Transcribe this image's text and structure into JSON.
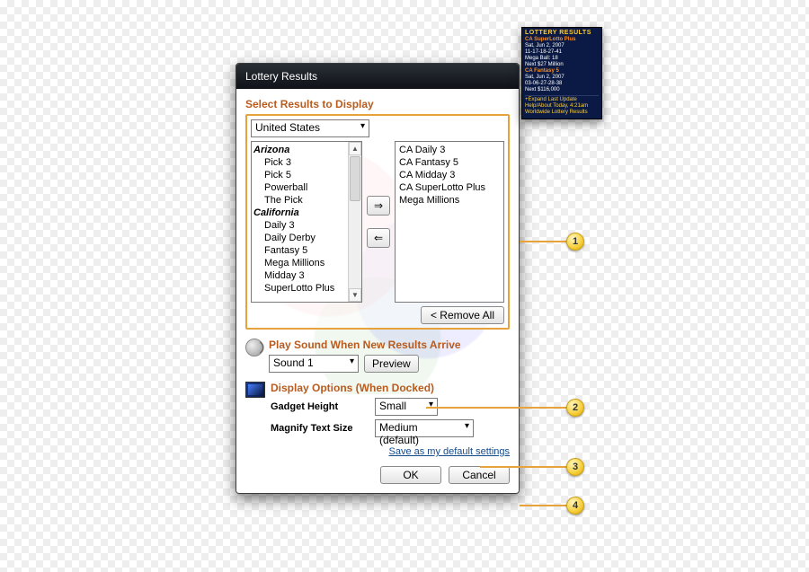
{
  "dialog": {
    "title": "Lottery Results",
    "section_select": "Select Results to Display",
    "country": "United States",
    "available": {
      "groups": [
        {
          "name": "Arizona",
          "games": [
            "Pick 3",
            "Pick 5",
            "Powerball",
            "The Pick"
          ]
        },
        {
          "name": "California",
          "games": [
            "Daily 3",
            "Daily Derby",
            "Fantasy 5",
            "Mega Millions",
            "Midday 3",
            "SuperLotto Plus"
          ]
        }
      ]
    },
    "selected": [
      "CA Daily 3",
      "CA Fantasy 5",
      "CA Midday 3",
      "CA SuperLotto Plus",
      "Mega Millions"
    ],
    "remove_all": "<  Remove All",
    "sound": {
      "title": "Play Sound When New Results Arrive",
      "value": "Sound 1",
      "preview": "Preview"
    },
    "display": {
      "title": "Display Options (When Docked)",
      "height_label": "Gadget Height",
      "height_value": "Small",
      "magnify_label": "Magnify Text Size",
      "magnify_value": "Medium (default)"
    },
    "save_link": "Save as my default settings",
    "ok": "OK",
    "cancel": "Cancel"
  },
  "gadget": {
    "header": "LOTTERY RESULTS",
    "blocks": [
      {
        "game": "CA SuperLotto Plus",
        "date": "Sat, Jun 2, 2007",
        "nums": "11-17-18-27-41",
        "extra": "Mega Ball: 18",
        "next": "Next $27 Million"
      },
      {
        "game": "CA Fantasy 5",
        "date": "Sat, Jun 2, 2007",
        "nums": "03-06-27-28-38",
        "extra": "",
        "next": "Next $116,000"
      }
    ],
    "foot1": "+Expand    Last Update",
    "foot2": "Help/About  Today, 4:21am",
    "foot3": "Worldwide Lottery Results"
  },
  "callouts": {
    "c1": "1",
    "c2": "2",
    "c3": "3",
    "c4": "4"
  }
}
